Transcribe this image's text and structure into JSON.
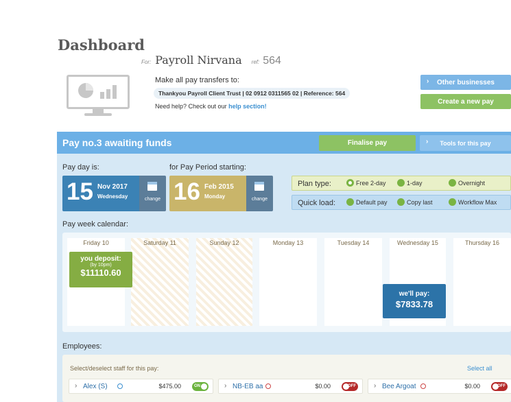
{
  "header": {
    "title": "Dashboard",
    "for_label": "For:",
    "business_name": "Payroll Nirvana",
    "ref_label": "ref:",
    "ref_value": "564"
  },
  "transfer": {
    "label": "Make all pay transfers to:",
    "account": "Thankyou Payroll Client Trust | 02 0912 0311565 02 | Reference: 564",
    "help_prefix": "Need help? Check out our",
    "help_link": "help section!"
  },
  "actions": {
    "other_businesses": "Other businesses",
    "create_pay": "Create a new pay"
  },
  "pay_panel": {
    "title": "Pay no.3 awaiting funds",
    "finalise": "Finalise pay",
    "tools": "Tools for this pay"
  },
  "pay_day": {
    "label": "Pay day is:",
    "day": "15",
    "month_year": "Nov 2017",
    "weekday": "Wednesday",
    "change": "change"
  },
  "period": {
    "label": "for Pay Period starting:",
    "day": "16",
    "month_year": "Feb 2015",
    "weekday": "Monday",
    "change": "change"
  },
  "plan": {
    "label": "Plan type:",
    "options": [
      "Free 2-day",
      "1-day",
      "Overnight"
    ],
    "selected": "Free 2-day"
  },
  "quick_load": {
    "label": "Quick load:",
    "options": [
      "Default pay",
      "Copy last",
      "Workflow Max"
    ]
  },
  "calendar": {
    "label": "Pay week calendar:",
    "days": [
      "Friday 10",
      "Saturday 11",
      "Sunday 12",
      "Monday 13",
      "Tuesday 14",
      "Wednesday 15",
      "Thursday 16"
    ],
    "deposit_title": "you deposit:",
    "deposit_sub": "(by 10pm)",
    "deposit_amount": "$11110.60",
    "pay_title": "we'll pay:",
    "pay_amount": "$7833.78"
  },
  "employees": {
    "label": "Employees:",
    "select_text": "Select/deselect staff for this pay:",
    "select_all": "Select all",
    "list": [
      {
        "name": "Alex (S)",
        "amount": "$475.00",
        "status": "ON"
      },
      {
        "name": "NB-EB aa",
        "amount": "$0.00",
        "status": "OFF"
      },
      {
        "name": "Bee Argoat",
        "amount": "$0.00",
        "status": "OFF"
      }
    ]
  },
  "colors": {
    "blue": "#6cb0e6",
    "green": "#8dc263",
    "paydate": "#3b82b5",
    "period": "#c9b56a",
    "deposit": "#85ad43",
    "pay": "#2c73a8"
  }
}
